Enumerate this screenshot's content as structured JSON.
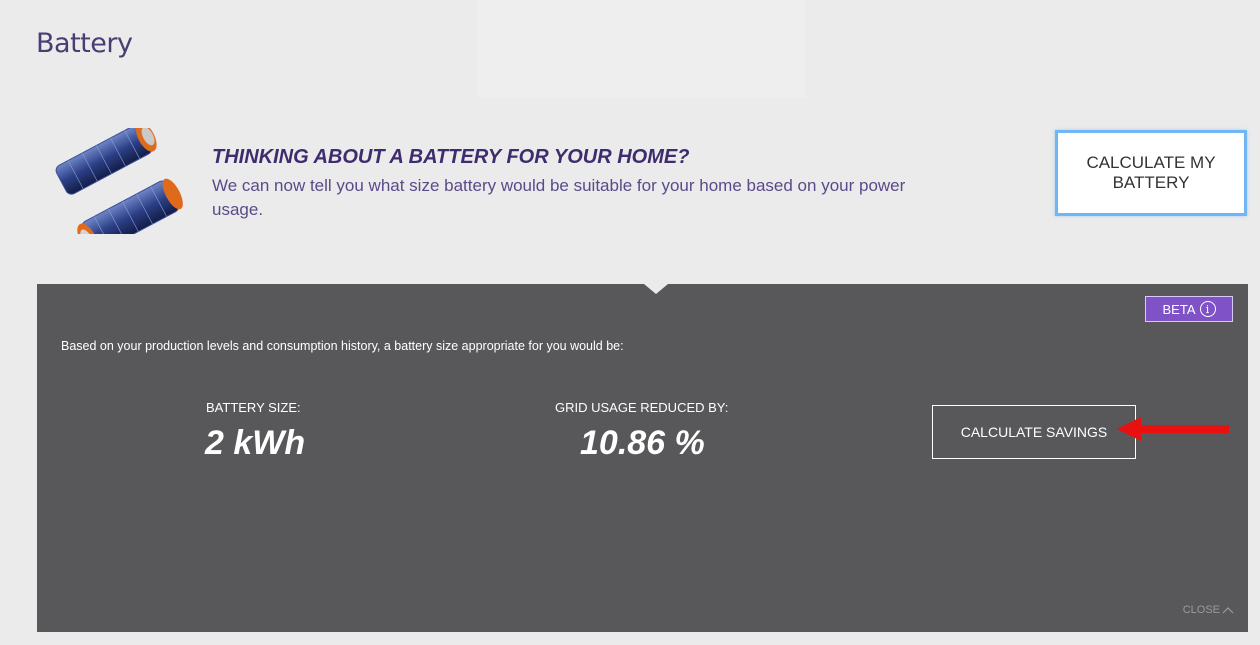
{
  "page": {
    "title": "Battery"
  },
  "promo": {
    "heading": "THINKING ABOUT A BATTERY FOR YOUR HOME?",
    "text": "We can now tell you what size battery would be suitable for your home based on your power usage.",
    "calculate_button": "CALCULATE MY BATTERY",
    "image_icon": "solar-battery-image"
  },
  "panel": {
    "beta_label": "BETA",
    "info_icon": "info-icon",
    "intro": "Based on your production levels and consumption history, a battery size appropriate for you would be:",
    "battery_size_label": "BATTERY SIZE:",
    "battery_size_value": "2 kWh",
    "grid_label": "GRID USAGE REDUCED BY:",
    "grid_value": "10.86 %",
    "savings_button": "CALCULATE SAVINGS",
    "close_label": "CLOSE",
    "close_icon": "chevron-up-icon"
  },
  "colors": {
    "brand_purple": "#3e2c6e",
    "beta_purple": "#7f52c7",
    "panel_gray": "#58585a",
    "highlight_blue": "#6fb6f3",
    "annotation_red": "#e8110f"
  }
}
